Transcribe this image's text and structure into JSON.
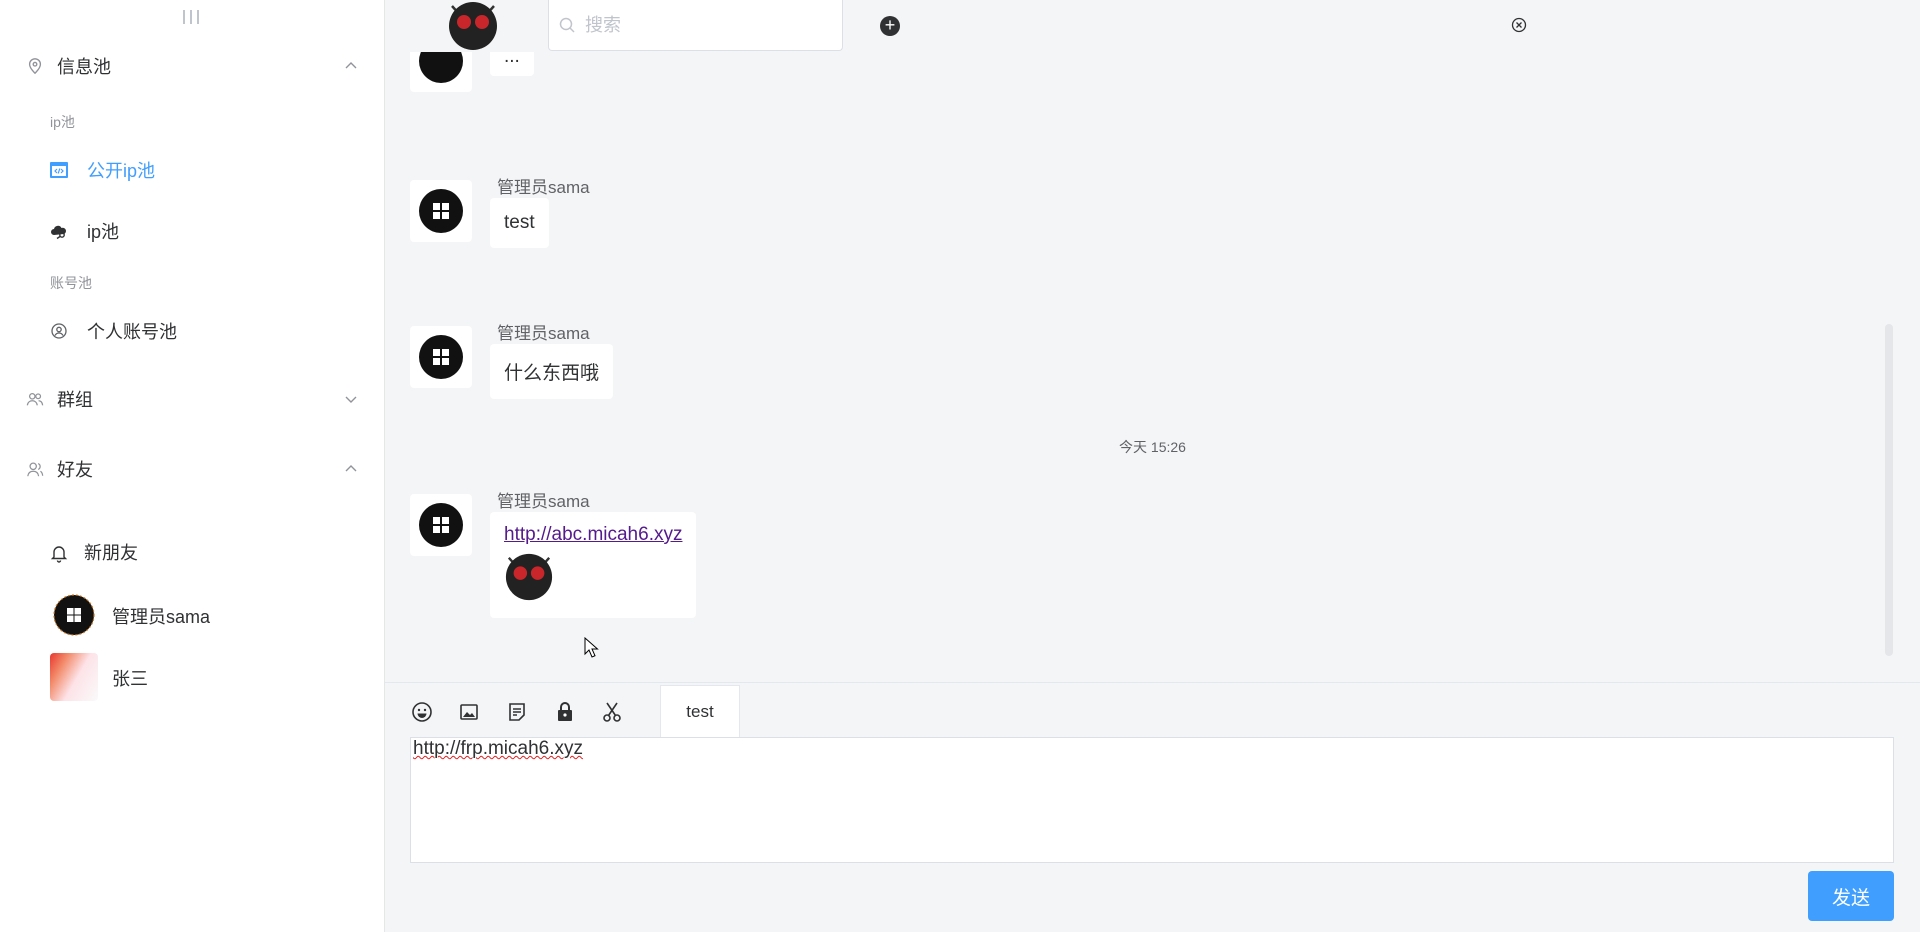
{
  "sidebar": {
    "groups": {
      "info_pool": "信息池",
      "groups": "群组",
      "friends": "好友"
    },
    "sub_titles": {
      "ip_pool": "ip池",
      "account_pool": "账号池"
    },
    "items": {
      "public_ip_pool": "公开ip池",
      "ip_pool": "ip池",
      "personal_account_pool": "个人账号池"
    },
    "friends": {
      "new_friend": "新朋友",
      "admin": "管理员sama",
      "zhangsan": "张三"
    },
    "accent_color": "#409eff"
  },
  "header": {
    "search_placeholder": "搜索"
  },
  "messages": [
    {
      "sender": "",
      "text": "..."
    },
    {
      "sender": "管理员sama",
      "text": "test"
    },
    {
      "sender": "管理员sama",
      "text": "什么东西哦"
    },
    {
      "sender": "管理员sama",
      "link": "http://abc.micah6.xyz"
    }
  ],
  "time_separator": "今天 15:26",
  "composer": {
    "quick_reply": "test",
    "draft": "http://frp.micah6.xyz",
    "send_label": "发送"
  },
  "icons": {
    "toolbar": [
      "emoji-icon",
      "image-icon",
      "note-icon",
      "lock-icon",
      "scissors-icon"
    ]
  }
}
